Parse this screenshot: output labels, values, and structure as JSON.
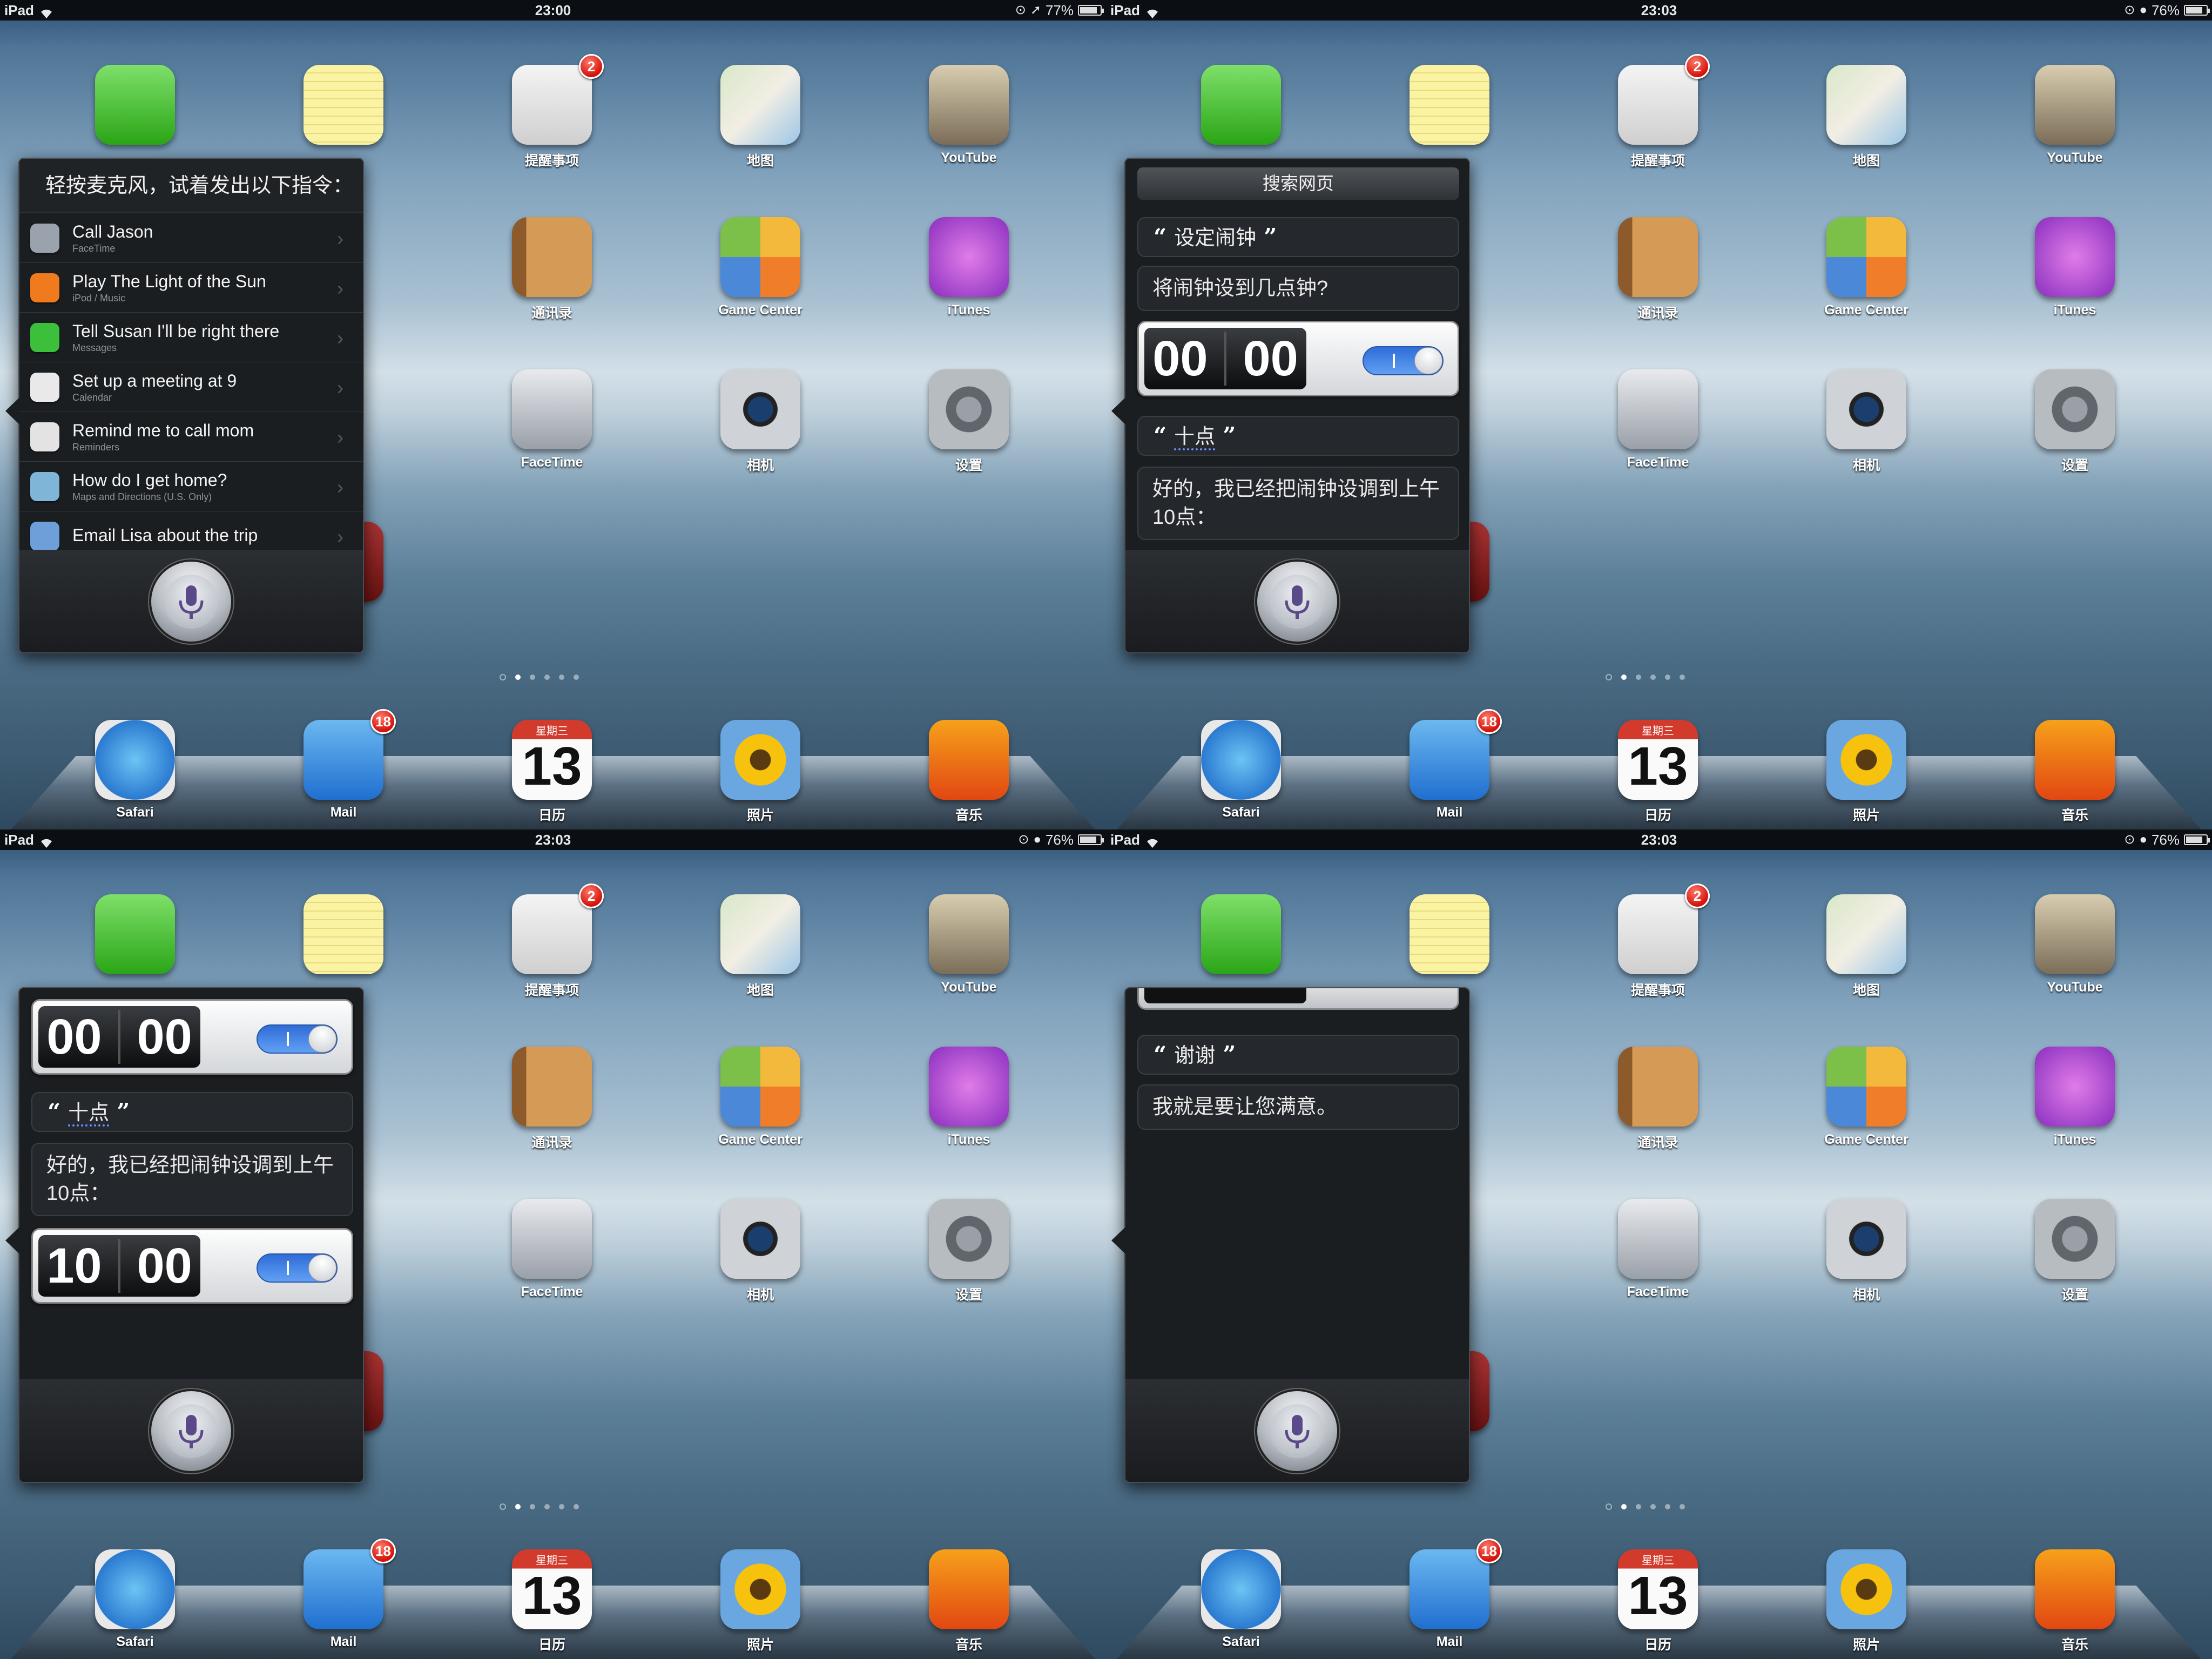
{
  "status_bar": {
    "device": "iPad",
    "times": [
      "23:00",
      "23:03",
      "23:03",
      "23:03"
    ],
    "batteries": [
      "77%",
      "76%",
      "76%",
      "76%"
    ]
  },
  "apps": [
    {
      "label": "",
      "icon": "messages-icon"
    },
    {
      "label": "",
      "icon": "notes-icon"
    },
    {
      "label": "提醒事项",
      "icon": "reminders-icon",
      "badge": "2"
    },
    {
      "label": "地图",
      "icon": "maps-icon"
    },
    {
      "label": "YouTube",
      "icon": "youtube-icon"
    },
    {
      "label": "通讯录",
      "icon": "contacts-icon"
    },
    {
      "label": "Game Center",
      "icon": "game-center-icon"
    },
    {
      "label": "iTunes",
      "icon": "itunes-icon"
    },
    {
      "label": "FaceTime",
      "icon": "facetime-icon"
    },
    {
      "label": "相机",
      "icon": "camera-icon"
    },
    {
      "label": "设置",
      "icon": "settings-icon"
    }
  ],
  "dock": [
    {
      "label": "Safari",
      "icon": "safari-icon"
    },
    {
      "label": "Mail",
      "icon": "mail-icon",
      "badge": "18"
    },
    {
      "label": "日历",
      "icon": "calendar-icon",
      "weekday": "星期三",
      "day": "13"
    },
    {
      "label": "照片",
      "icon": "photos-icon"
    },
    {
      "label": "音乐",
      "icon": "music-icon"
    }
  ],
  "panel1": {
    "title": "轻按麦克风，试着发出以下指令：",
    "hints": [
      {
        "main": "Call Jason",
        "sub": "FaceTime",
        "color": "#9aa3ad"
      },
      {
        "main": "Play The Light of the Sun",
        "sub": "iPod / Music",
        "color": "#f07a1e"
      },
      {
        "main": "Tell Susan I'll be right there",
        "sub": "Messages",
        "color": "#3cbf3a"
      },
      {
        "main": "Set up a meeting at 9",
        "sub": "Calendar",
        "color": "#e9e9e9"
      },
      {
        "main": "Remind me to call mom",
        "sub": "Reminders",
        "color": "#e3e3e3"
      },
      {
        "main": "How do I get home?",
        "sub": "Maps and Directions (U.S. Only)",
        "color": "#7fb6d8"
      },
      {
        "main": "Email Lisa about the trip",
        "sub": "",
        "color": "#6e9fd8"
      }
    ]
  },
  "panel2": {
    "search_header": "搜索网页",
    "user_1": "设定闹钟",
    "siri_1": "将闹钟设到几点钟?",
    "alarm_1": {
      "hours": "00",
      "minutes": "00"
    },
    "user_2": "十点",
    "siri_2": "好的，我已经把闹钟设调到上午10点："
  },
  "panel3": {
    "alarm_1": {
      "hours": "00",
      "minutes": "00"
    },
    "user_2": "十点",
    "siri_2": "好的，我已经把闹钟设调到上午10点：",
    "alarm_2": {
      "hours": "10",
      "minutes": "00"
    }
  },
  "panel4": {
    "user_1": "谢谢",
    "siri_1": "我就是要让您满意。"
  },
  "quote_open": "“",
  "quote_close": "”"
}
